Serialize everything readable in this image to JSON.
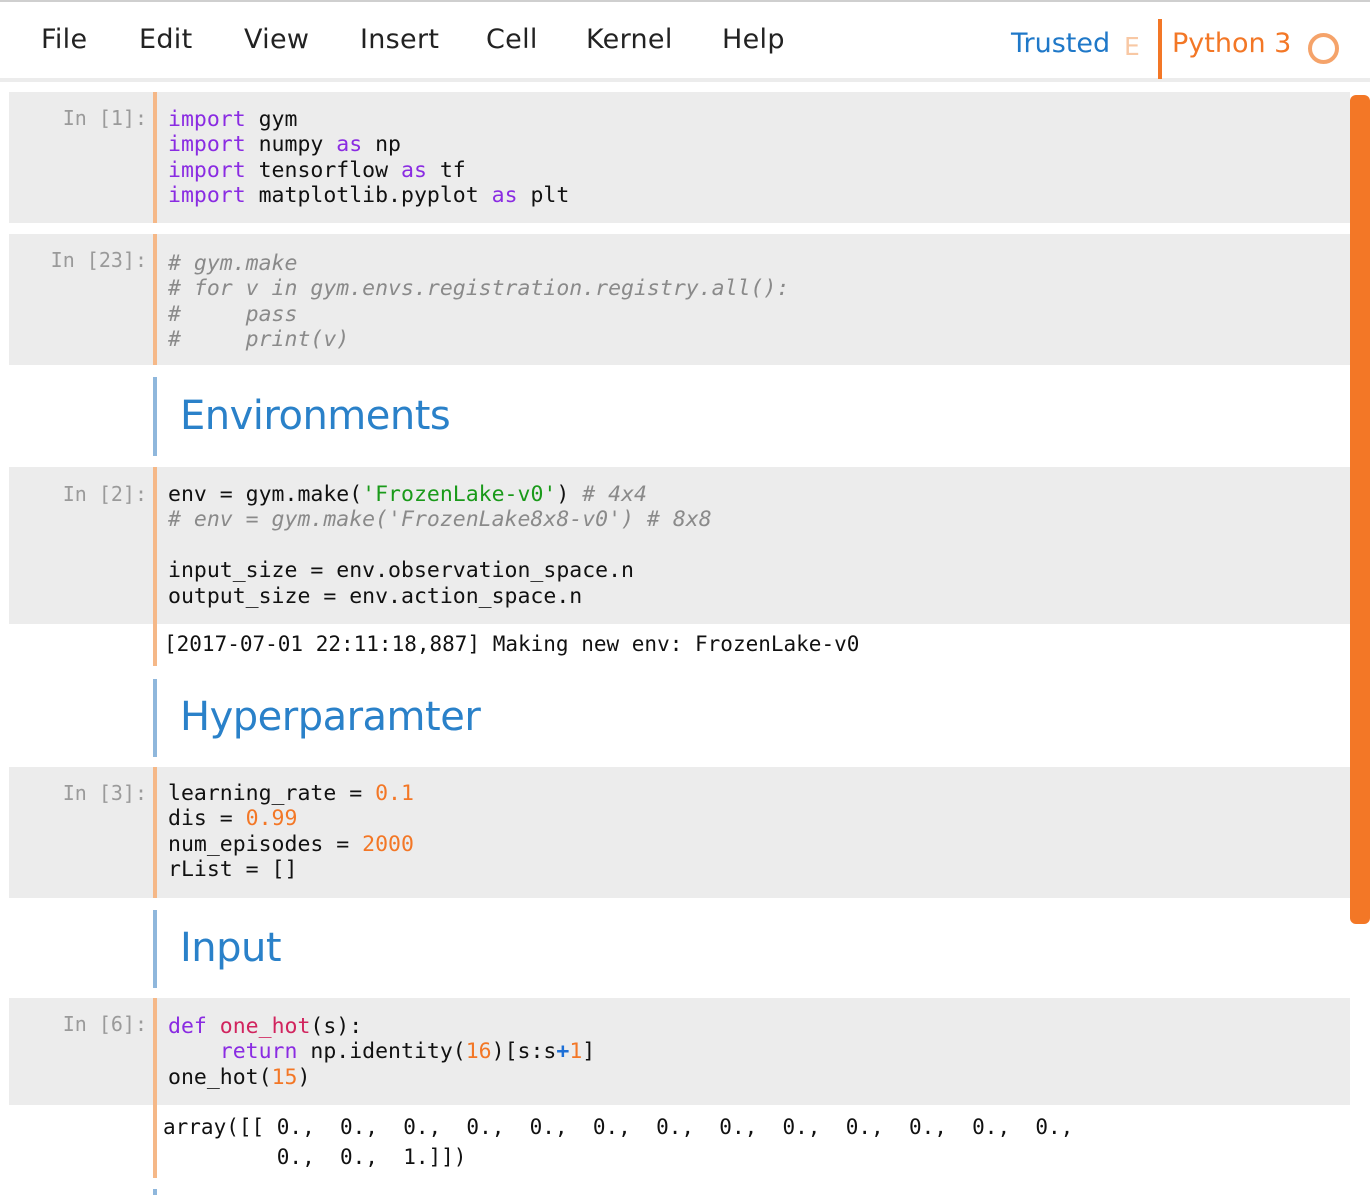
{
  "menubar": {
    "items": [
      "File",
      "Edit",
      "View",
      "Insert",
      "Cell",
      "Kernel",
      "Help"
    ],
    "trusted_label": "Trusted",
    "edit_mode_letter": "E",
    "kernel_name": "Python 3",
    "accent_color": "#f37726",
    "trusted_color": "#1f78c8"
  },
  "cells": {
    "c1": {
      "prompt": "In [1]:",
      "lines": [
        [
          "import",
          " gym"
        ],
        [
          "import",
          " numpy ",
          "as",
          " np"
        ],
        [
          "import",
          " tensorflow ",
          "as",
          " tf"
        ],
        [
          "import",
          " matplotlib.pyplot ",
          "as",
          " plt"
        ]
      ]
    },
    "c2": {
      "prompt": "In [23]:",
      "lines": [
        "# gym.make",
        "# for v in gym.envs.registration.registry.all():",
        "#     pass",
        "#     print(v)"
      ]
    },
    "md1": {
      "heading": "Environments"
    },
    "c3": {
      "prompt": "In [2]:",
      "line1_a": "env = gym.make(",
      "line1_str": "'FrozenLake-v0'",
      "line1_b": ") ",
      "line1_cm": "# 4x4",
      "line2": "# env = gym.make('FrozenLake8x8-v0') # 8x8",
      "line4": "input_size = env.observation_space.n",
      "line5": "output_size = env.action_space.n",
      "output": "[2017-07-01 22:11:18,887] Making new env: FrozenLake-v0"
    },
    "md2": {
      "heading": "Hyperparamter"
    },
    "c4": {
      "prompt": "In [3]:",
      "l1_a": "learning_rate = ",
      "l1_n": "0.1",
      "l2_a": "dis = ",
      "l2_n": "0.99",
      "l3_a": "num_episodes = ",
      "l3_n": "2000",
      "l4": "rList = []"
    },
    "md3": {
      "heading": "Input"
    },
    "c5": {
      "prompt": "In [6]:",
      "l1_kw": "def",
      "l1_fn": " one_hot",
      "l1_b": "(s):",
      "l2_kw": "    return",
      "l2_a": " np.identity(",
      "l2_n1": "16",
      "l2_b": ")[s:s",
      "l2_op": "+",
      "l2_n2": "1",
      "l2_c": "]",
      "l3_a": "one_hot(",
      "l3_n": "15",
      "l3_b": ")",
      "output_line1": "array([[ 0.,  0.,  0.,  0.,  0.,  0.,  0.,  0.,  0.,  0.,  0.,  0.,  0.,",
      "output_line2": "         0.,  0.,  1.]])"
    }
  }
}
